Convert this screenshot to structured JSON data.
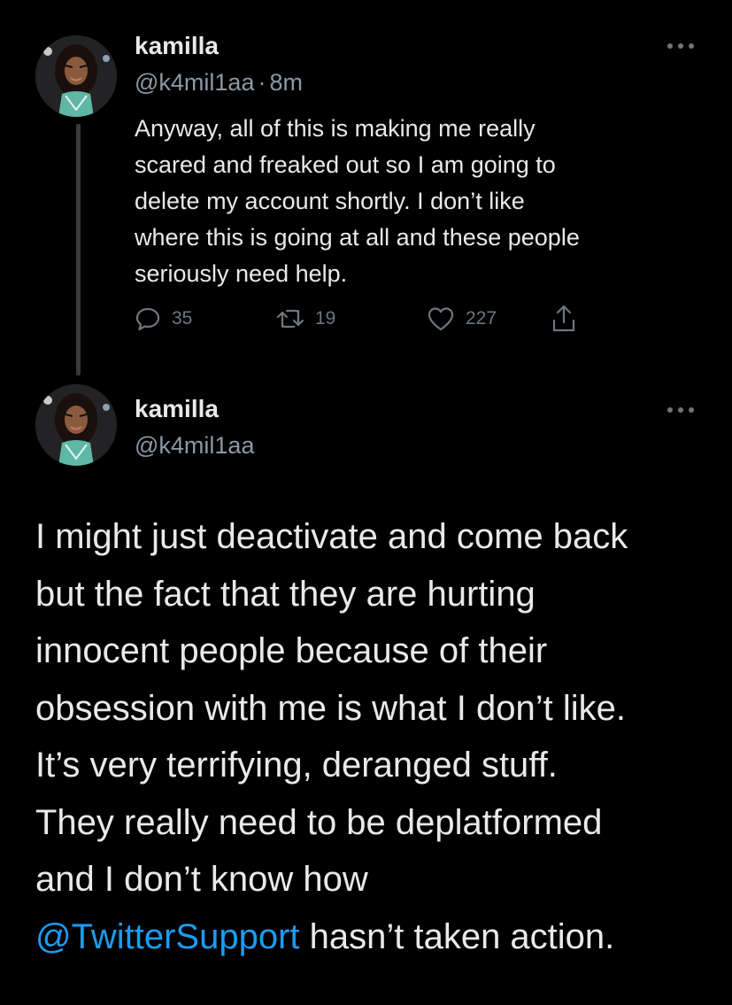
{
  "tweets": [
    {
      "author_name": "kamilla",
      "handle": "@k4mil1aa",
      "time_sep": "·",
      "time": "8m",
      "body_lines": [
        "Anyway, all of this is making me really",
        "scared and freaked out so I am going to",
        "delete my account shortly. I don’t like",
        "where this is going at all and these people",
        "seriously need help."
      ],
      "actions": {
        "reply_icon": "reply-icon",
        "reply_count": "35",
        "retweet_icon": "retweet-icon",
        "retweet_count": "19",
        "like_icon": "heart-icon",
        "like_count": "227",
        "share_icon": "share-icon"
      }
    },
    {
      "author_name": "kamilla",
      "handle": "@k4mil1aa",
      "body_lines": [
        "I might just deactivate and come back",
        "but the fact that they are hurting",
        "innocent people because of their",
        "obsession with me is what I don’t like.",
        "It’s very terrifying, deranged stuff.",
        "They really need to be deplatformed",
        "and I don’t know how"
      ],
      "mention": "@TwitterSupport",
      "last_line_rest": " hasn’t taken action."
    }
  ],
  "colors": {
    "background": "#000000",
    "text": "#e7e9ea",
    "secondary_text": "#8b98a5",
    "action_icon": "#6e767d",
    "mention": "#1d9bf0",
    "thread_line": "#3a3a3c"
  }
}
